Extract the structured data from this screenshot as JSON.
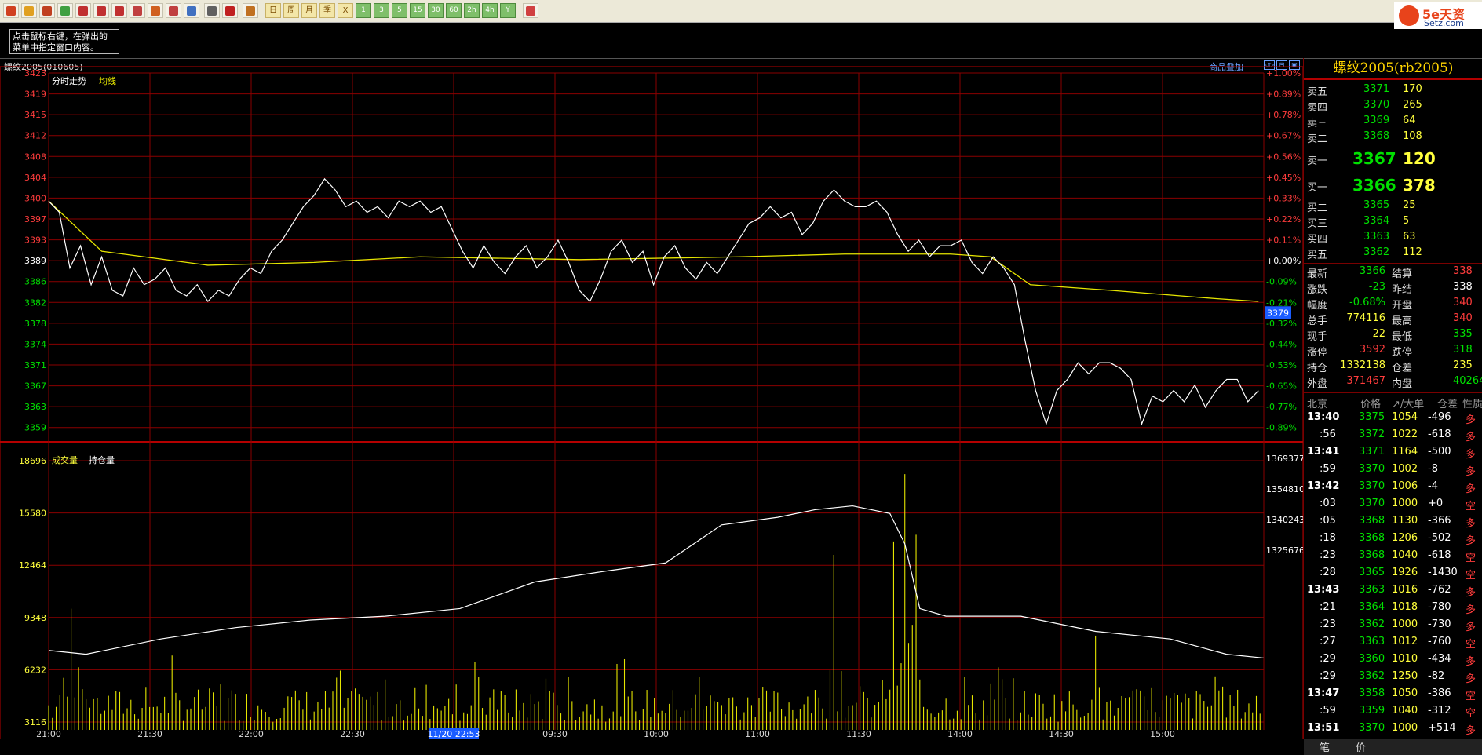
{
  "hint_text": [
    "点击鼠标右键，在弹出的",
    "菜单中指定窗口内容。"
  ],
  "chart_header": "螺纹2005(010605)",
  "overlay_label": "商品叠加",
  "toolbar": {
    "text_buttons": [
      "日",
      "周",
      "月",
      "季",
      "X"
    ],
    "num_buttons": [
      "1",
      "3",
      "5",
      "15",
      "30",
      "60",
      "2h",
      "4h",
      "Y"
    ]
  },
  "logo": {
    "name": "5e天资",
    "url": "Setz.com"
  },
  "colors": {
    "up": "#ff3c3c",
    "down": "#00e000",
    "grid": "#8a0000",
    "avg": "#e6e600",
    "price": "#ffffff"
  },
  "chart_data": [
    {
      "type": "line",
      "legend": [
        "分时走势",
        "均线"
      ],
      "y_ticks": [
        "3423",
        "3419",
        "3415",
        "3412",
        "3408",
        "3404",
        "3400",
        "3397",
        "3393",
        "3389",
        "3386",
        "3382",
        "3378",
        "3374",
        "3371",
        "3367",
        "3363",
        "3359"
      ],
      "pct_ticks": [
        "+1.00%",
        "+0.89%",
        "+0.78%",
        "+0.67%",
        "+0.56%",
        "+0.45%",
        "+0.33%",
        "+0.22%",
        "+0.11%",
        "+0.00%",
        "-0.09%",
        "-0.21%",
        "-0.32%",
        "-0.44%",
        "-0.53%",
        "-0.65%",
        "-0.77%",
        "-0.89%"
      ],
      "ylim": [
        3357.5,
        3423
      ],
      "current_price_tag": "3379",
      "x_labels": [
        "21:00",
        "21:30",
        "22:00",
        "22:30",
        "11/20 22:53",
        "09:30",
        "10:00",
        "11:00",
        "11:30",
        "14:00",
        "14:30",
        "15:00"
      ],
      "price": [
        [
          0,
          3400
        ],
        [
          4,
          3398
        ],
        [
          8,
          3388
        ],
        [
          12,
          3392
        ],
        [
          16,
          3385
        ],
        [
          20,
          3390
        ],
        [
          24,
          3384
        ],
        [
          28,
          3383
        ],
        [
          32,
          3388
        ],
        [
          36,
          3385
        ],
        [
          40,
          3386
        ],
        [
          44,
          3388
        ],
        [
          48,
          3384
        ],
        [
          52,
          3383
        ],
        [
          56,
          3385
        ],
        [
          60,
          3382
        ],
        [
          64,
          3384
        ],
        [
          68,
          3383
        ],
        [
          72,
          3386
        ],
        [
          76,
          3388
        ],
        [
          80,
          3387
        ],
        [
          84,
          3391
        ],
        [
          88,
          3393
        ],
        [
          92,
          3396
        ],
        [
          96,
          3399
        ],
        [
          100,
          3401
        ],
        [
          104,
          3404
        ],
        [
          108,
          3402
        ],
        [
          112,
          3399
        ],
        [
          116,
          3400
        ],
        [
          120,
          3398
        ],
        [
          124,
          3399
        ],
        [
          128,
          3397
        ],
        [
          132,
          3400
        ],
        [
          136,
          3399
        ],
        [
          140,
          3400
        ],
        [
          144,
          3398
        ],
        [
          148,
          3399
        ],
        [
          152,
          3395
        ],
        [
          156,
          3391
        ],
        [
          160,
          3388
        ],
        [
          164,
          3392
        ],
        [
          168,
          3389
        ],
        [
          172,
          3387
        ],
        [
          176,
          3390
        ],
        [
          180,
          3392
        ],
        [
          184,
          3388
        ],
        [
          188,
          3390
        ],
        [
          192,
          3393
        ],
        [
          196,
          3389
        ],
        [
          200,
          3384
        ],
        [
          204,
          3382
        ],
        [
          208,
          3386
        ],
        [
          212,
          3391
        ],
        [
          216,
          3393
        ],
        [
          220,
          3389
        ],
        [
          224,
          3391
        ],
        [
          228,
          3385
        ],
        [
          232,
          3390
        ],
        [
          236,
          3392
        ],
        [
          240,
          3388
        ],
        [
          244,
          3386
        ],
        [
          248,
          3389
        ],
        [
          252,
          3387
        ],
        [
          256,
          3390
        ],
        [
          260,
          3393
        ],
        [
          264,
          3396
        ],
        [
          268,
          3397
        ],
        [
          272,
          3399
        ],
        [
          276,
          3397
        ],
        [
          280,
          3398
        ],
        [
          284,
          3394
        ],
        [
          288,
          3396
        ],
        [
          292,
          3400
        ],
        [
          296,
          3402
        ],
        [
          300,
          3400
        ],
        [
          304,
          3399
        ],
        [
          308,
          3399
        ],
        [
          312,
          3400
        ],
        [
          316,
          3398
        ],
        [
          320,
          3394
        ],
        [
          324,
          3391
        ],
        [
          328,
          3393
        ],
        [
          332,
          3390
        ],
        [
          336,
          3392
        ],
        [
          340,
          3392
        ],
        [
          344,
          3393
        ],
        [
          348,
          3389
        ],
        [
          352,
          3387
        ],
        [
          356,
          3390
        ],
        [
          360,
          3388
        ],
        [
          364,
          3385
        ],
        [
          368,
          3375
        ],
        [
          372,
          3366
        ],
        [
          376,
          3360
        ],
        [
          380,
          3366
        ],
        [
          384,
          3368
        ],
        [
          388,
          3371
        ],
        [
          392,
          3369
        ],
        [
          396,
          3371
        ],
        [
          400,
          3371
        ],
        [
          404,
          3370
        ],
        [
          408,
          3368
        ],
        [
          412,
          3360
        ],
        [
          416,
          3365
        ],
        [
          420,
          3364
        ],
        [
          424,
          3366
        ],
        [
          428,
          3364
        ],
        [
          432,
          3367
        ],
        [
          436,
          3363
        ],
        [
          440,
          3366
        ],
        [
          444,
          3368
        ],
        [
          448,
          3368
        ],
        [
          452,
          3364
        ],
        [
          456,
          3366
        ]
      ],
      "average": [
        [
          0,
          3400
        ],
        [
          20,
          3391
        ],
        [
          60,
          3388.5
        ],
        [
          100,
          3389
        ],
        [
          140,
          3390
        ],
        [
          200,
          3389.5
        ],
        [
          260,
          3390
        ],
        [
          300,
          3390.5
        ],
        [
          340,
          3390.5
        ],
        [
          355,
          3390
        ],
        [
          370,
          3385
        ],
        [
          400,
          3384
        ],
        [
          440,
          3382.5
        ],
        [
          456,
          3382
        ]
      ]
    },
    {
      "type": "bar",
      "legend": [
        "成交量",
        "持仓量"
      ],
      "vol_ticks": [
        "18696",
        "15580",
        "12464",
        "9348",
        "6232",
        "3116"
      ],
      "oi_ticks": [
        "1369377",
        "1354810",
        "1340243",
        "1325676"
      ],
      "volume_max": 20000,
      "oi_range": [
        1311109,
        1383944
      ],
      "open_interest": [
        [
          0,
          1332000
        ],
        [
          20,
          1331000
        ],
        [
          60,
          1335000
        ],
        [
          100,
          1338000
        ],
        [
          140,
          1340000
        ],
        [
          180,
          1341000
        ],
        [
          220,
          1343000
        ],
        [
          260,
          1350000
        ],
        [
          300,
          1353000
        ],
        [
          330,
          1355000
        ],
        [
          360,
          1365000
        ],
        [
          390,
          1367000
        ],
        [
          410,
          1369000
        ],
        [
          430,
          1370000
        ],
        [
          450,
          1368000
        ],
        [
          458,
          1360000
        ],
        [
          466,
          1343000
        ],
        [
          480,
          1341000
        ],
        [
          520,
          1341000
        ],
        [
          560,
          1337000
        ],
        [
          600,
          1335000
        ],
        [
          630,
          1331000
        ],
        [
          650,
          1330000
        ]
      ],
      "volume_spikes": [
        [
          12,
          9000
        ],
        [
          215,
          7200
        ],
        [
          375,
          4200
        ],
        [
          420,
          13000
        ],
        [
          452,
          14000
        ],
        [
          458,
          19000
        ],
        [
          464,
          14500
        ],
        [
          560,
          7000
        ]
      ]
    }
  ],
  "quote": {
    "title": "螺纹2005(rb2005)",
    "asks": [
      {
        "label": "卖五",
        "price": "3371",
        "vol": "170"
      },
      {
        "label": "卖四",
        "price": "3370",
        "vol": "265"
      },
      {
        "label": "卖三",
        "price": "3369",
        "vol": "64"
      },
      {
        "label": "卖二",
        "price": "3368",
        "vol": "108"
      },
      {
        "label": "卖一",
        "price": "3367",
        "vol": "120"
      }
    ],
    "bids": [
      {
        "label": "买一",
        "price": "3366",
        "vol": "378"
      },
      {
        "label": "买二",
        "price": "3365",
        "vol": "25"
      },
      {
        "label": "买三",
        "price": "3364",
        "vol": "5"
      },
      {
        "label": "买四",
        "price": "3363",
        "vol": "63"
      },
      {
        "label": "买五",
        "price": "3362",
        "vol": "112"
      }
    ],
    "stats": [
      {
        "l1": "最新",
        "v1": "3366",
        "c1": "green",
        "l2": "结算",
        "v2": "338",
        "c2": "red"
      },
      {
        "l1": "涨跌",
        "v1": "-23",
        "c1": "green",
        "l2": "昨结",
        "v2": "338",
        "c2": "white"
      },
      {
        "l1": "幅度",
        "v1": "-0.68%",
        "c1": "green",
        "l2": "开盘",
        "v2": "340",
        "c2": "red"
      },
      {
        "l1": "总手",
        "v1": "774116",
        "c1": "yellow",
        "l2": "最高",
        "v2": "340",
        "c2": "red"
      },
      {
        "l1": "现手",
        "v1": "22",
        "c1": "yellow",
        "l2": "最低",
        "v2": "335",
        "c2": "green"
      },
      {
        "l1": "涨停",
        "v1": "3592",
        "c1": "red",
        "l2": "跌停",
        "v2": "318",
        "c2": "green"
      },
      {
        "l1": "持仓",
        "v1": "1332138",
        "c1": "yellow",
        "l2": "仓差",
        "v2": "235",
        "c2": "yellow"
      },
      {
        "l1": "外盘",
        "v1": "371467",
        "c1": "red",
        "l2": "内盘",
        "v2": "40264",
        "c2": "green"
      }
    ],
    "tick_headers": [
      "北京",
      "价格",
      "↗/大单",
      "仓差",
      "性质"
    ],
    "ticks": [
      {
        "t": "13:40",
        "p": "3375",
        "v": "1054",
        "d": "-496",
        "n": "多"
      },
      {
        "t": ":56",
        "p": "3372",
        "v": "1022",
        "d": "-618",
        "n": "多"
      },
      {
        "t": "13:41",
        "p": "3371",
        "v": "1164",
        "d": "-500",
        "n": "多"
      },
      {
        "t": ":59",
        "p": "3370",
        "v": "1002",
        "d": "-8",
        "n": "多"
      },
      {
        "t": "13:42",
        "p": "3370",
        "v": "1006",
        "d": "-4",
        "n": "多"
      },
      {
        "t": ":03",
        "p": "3370",
        "v": "1000",
        "d": "+0",
        "n": "空"
      },
      {
        "t": ":05",
        "p": "3368",
        "v": "1130",
        "d": "-366",
        "n": "多"
      },
      {
        "t": ":18",
        "p": "3368",
        "v": "1206",
        "d": "-502",
        "n": "多"
      },
      {
        "t": ":23",
        "p": "3368",
        "v": "1040",
        "d": "-618",
        "n": "空"
      },
      {
        "t": ":28",
        "p": "3365",
        "v": "1926",
        "d": "-1430",
        "n": "空"
      },
      {
        "t": "13:43",
        "p": "3363",
        "v": "1016",
        "d": "-762",
        "n": "多"
      },
      {
        "t": ":21",
        "p": "3364",
        "v": "1018",
        "d": "-780",
        "n": "多"
      },
      {
        "t": ":23",
        "p": "3362",
        "v": "1000",
        "d": "-730",
        "n": "多"
      },
      {
        "t": ":27",
        "p": "3363",
        "v": "1012",
        "d": "-760",
        "n": "空"
      },
      {
        "t": ":29",
        "p": "3360",
        "v": "1010",
        "d": "-434",
        "n": "多"
      },
      {
        "t": ":29",
        "p": "3362",
        "v": "1250",
        "d": "-82",
        "n": "多"
      },
      {
        "t": "13:47",
        "p": "3358",
        "v": "1050",
        "d": "-386",
        "n": "空"
      },
      {
        "t": ":59",
        "p": "3359",
        "v": "1040",
        "d": "-312",
        "n": "空"
      },
      {
        "t": "13:51",
        "p": "3370",
        "v": "1000",
        "d": "+514",
        "n": "多"
      }
    ],
    "footer_tabs": [
      "笔",
      "价"
    ]
  }
}
